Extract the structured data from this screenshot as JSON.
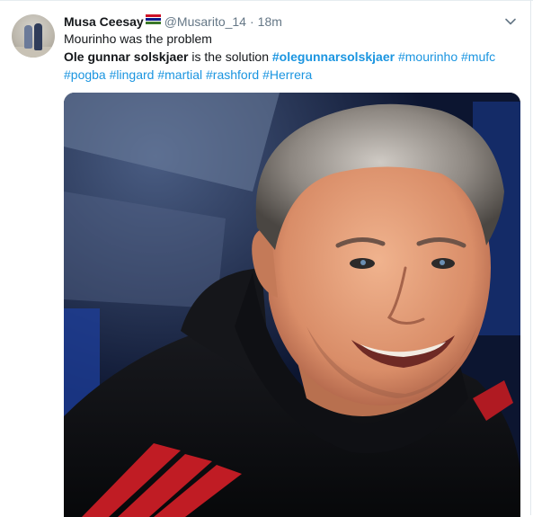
{
  "user": {
    "name": "Musa Ceesay",
    "handle": "@Musarito_14",
    "time": "18m",
    "separator": "·"
  },
  "tweet": {
    "line1": "Mourinho was the problem",
    "line2_bold": "Ole gunnar solskjaer",
    "line2_text": " is the solution ",
    "hashtags_line2": [
      "#olegunnarsolskjaer",
      "#mourinho",
      "#mufc"
    ],
    "hashtags_line3": [
      "#pogba",
      "#lingard",
      "#martial",
      "#rashford",
      "#Herrera"
    ]
  },
  "icons": {
    "avatar": "profile-photo",
    "flag": "gambia-flag-emoji",
    "caret": "chevron-down-icon"
  },
  "colors": {
    "text": "#14171a",
    "secondary": "#657786",
    "link": "#1b95e0",
    "flag_red": "#ce1126",
    "flag_blue": "#0c1c8c",
    "flag_green": "#3a7728"
  }
}
